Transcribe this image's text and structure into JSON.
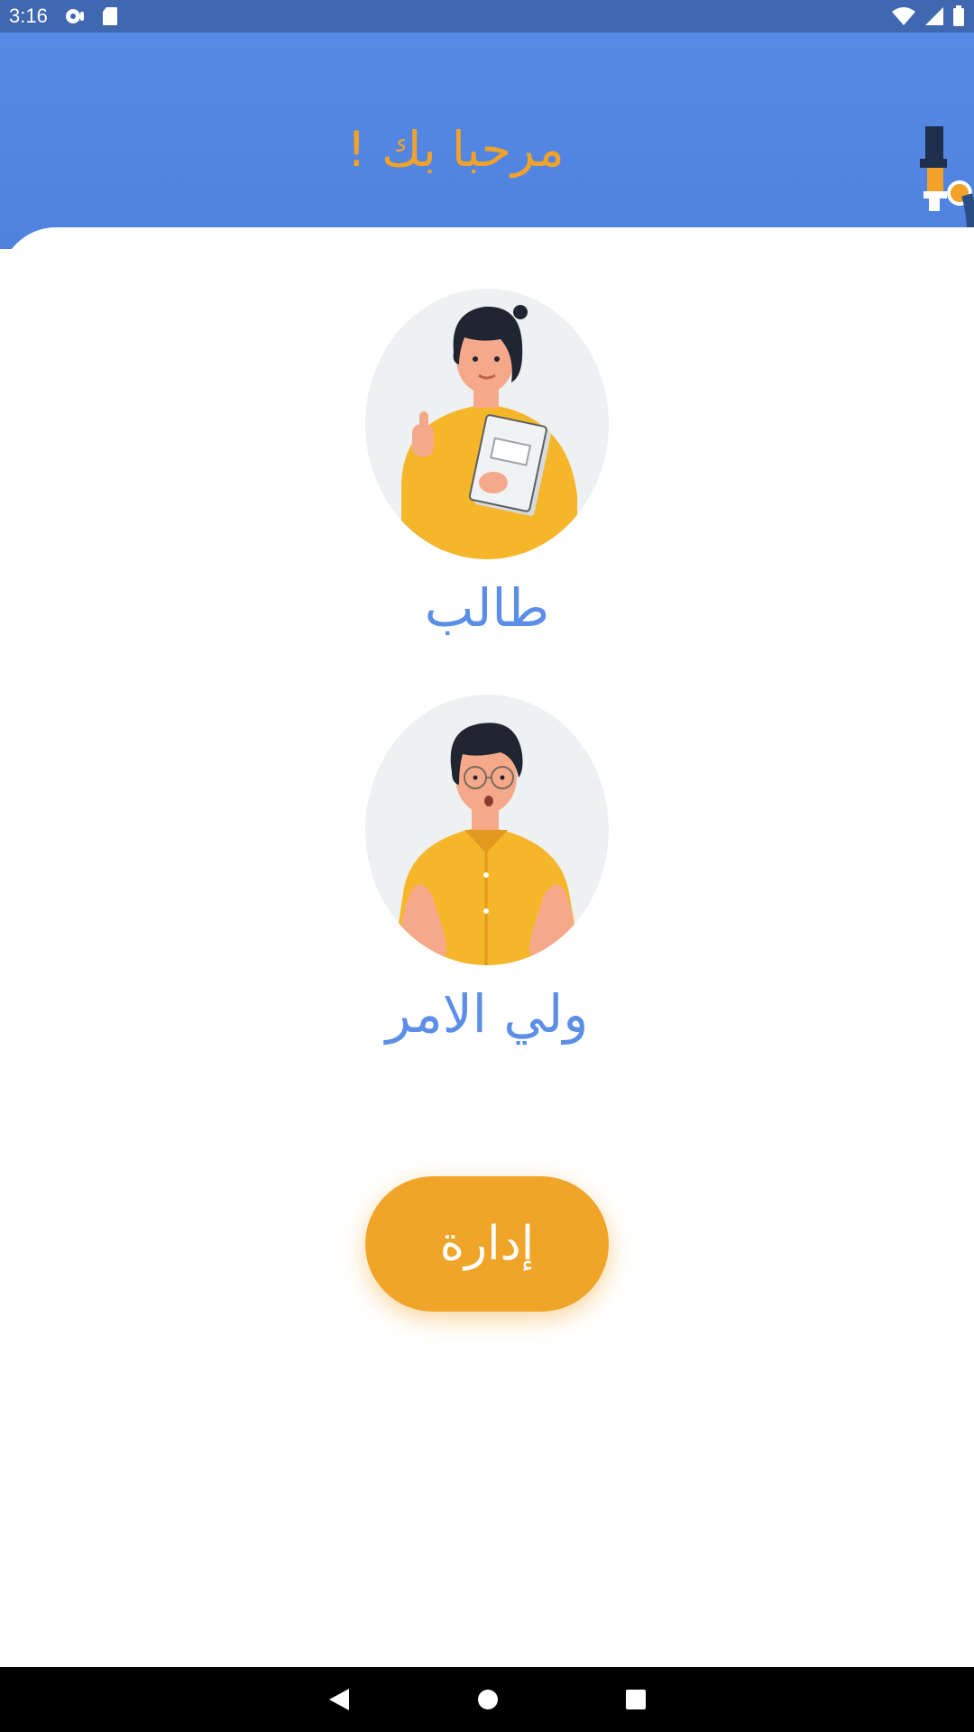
{
  "status_bar": {
    "time": "3:16",
    "icons": [
      "notification-icon",
      "sd-card-icon",
      "wifi-icon",
      "signal-icon",
      "battery-icon"
    ]
  },
  "header": {
    "title": "مرحبا بك !",
    "decoration_icon": "microscope-icon"
  },
  "roles": [
    {
      "label": "طالب",
      "image": "student-illustration"
    },
    {
      "label": "ولي الامر",
      "image": "parent-illustration"
    }
  ],
  "admin_button": {
    "label": "إدارة"
  },
  "nav_bar": {
    "buttons": [
      "back-icon",
      "home-icon",
      "recents-icon"
    ]
  },
  "colors": {
    "status_bar": "#3f68b0",
    "header": "#558ae6",
    "accent_orange": "#f0a428",
    "label_blue": "#5b8ee6",
    "avatar_bg": "#eef1f2"
  }
}
